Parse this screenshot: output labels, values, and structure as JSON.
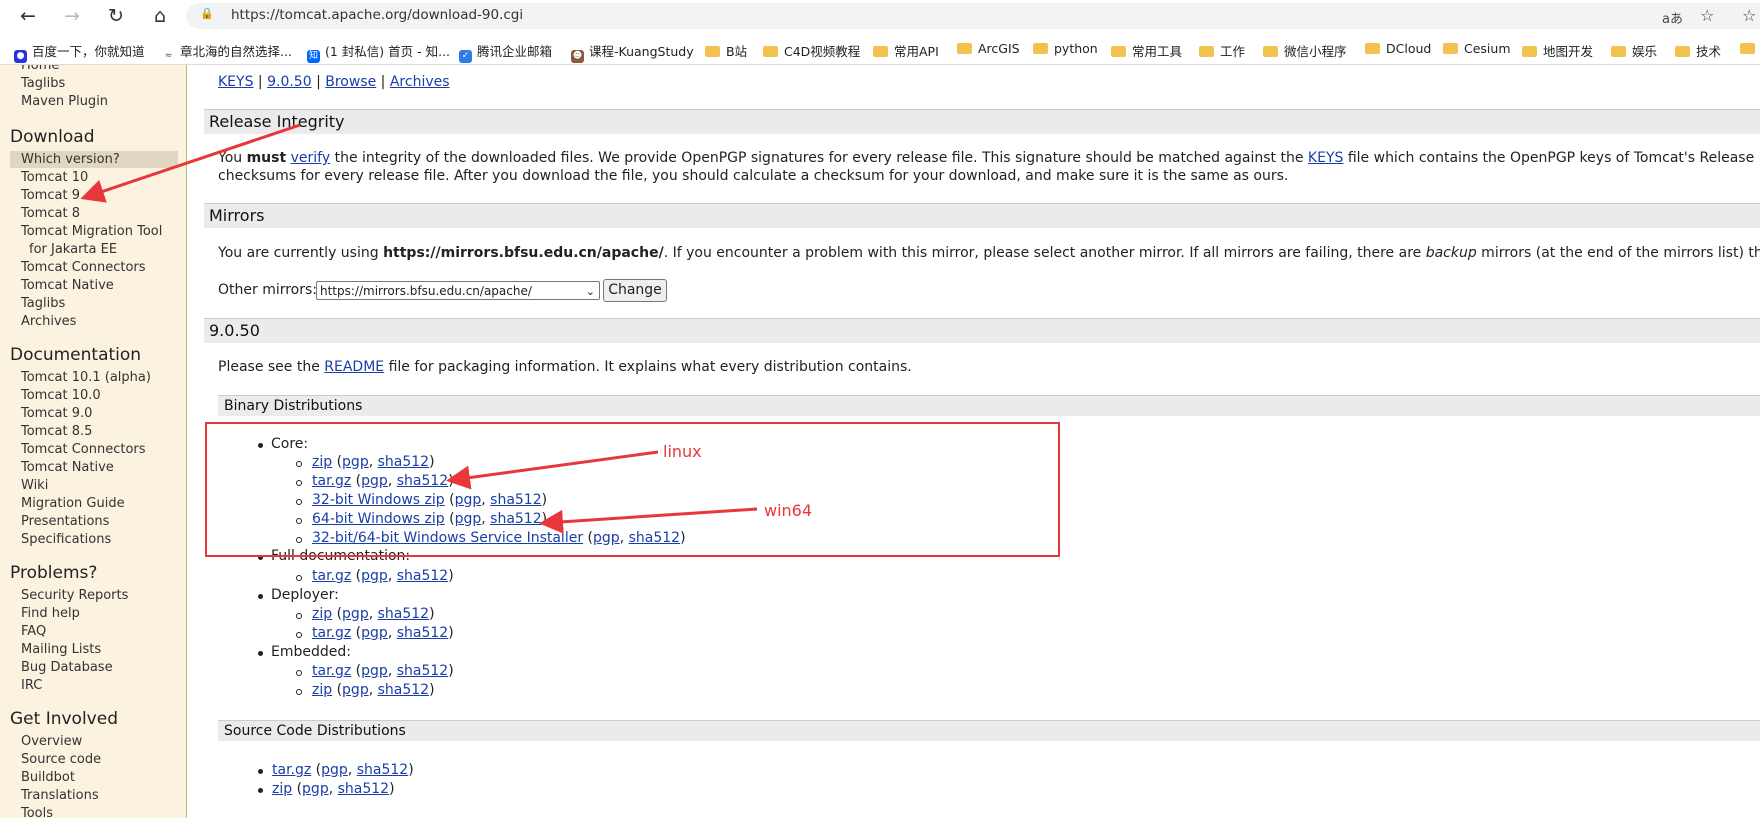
{
  "browser": {
    "url": "https://tomcat.apache.org/download-90.cgi",
    "bookmarks": [
      {
        "label": "百度一下，你就知道",
        "kind": "site",
        "color": "#2932e1"
      },
      {
        "label": "章北海的自然选择...",
        "kind": "site",
        "color": "#555555"
      },
      {
        "label": "(1 封私信) 首页 - 知...",
        "kind": "site",
        "color": "#0066ff"
      },
      {
        "label": "腾讯企业邮箱",
        "kind": "site",
        "color": "#2f7bea"
      },
      {
        "label": "课程-KuangStudy",
        "kind": "site",
        "color": "#8a5a3a"
      },
      {
        "label": "B站",
        "kind": "folder"
      },
      {
        "label": "C4D视频教程",
        "kind": "folder"
      },
      {
        "label": "常用API",
        "kind": "folder"
      },
      {
        "label": "ArcGIS",
        "kind": "folder"
      },
      {
        "label": "python",
        "kind": "folder"
      },
      {
        "label": "常用工具",
        "kind": "folder"
      },
      {
        "label": "工作",
        "kind": "folder"
      },
      {
        "label": "微信小程序",
        "kind": "folder"
      },
      {
        "label": "DCloud",
        "kind": "folder"
      },
      {
        "label": "Cesium",
        "kind": "folder"
      },
      {
        "label": "地图开发",
        "kind": "folder"
      },
      {
        "label": "娱乐",
        "kind": "folder"
      },
      {
        "label": "技术",
        "kind": "folder"
      }
    ]
  },
  "sidebar": {
    "top_items": [
      "Home",
      "Taglibs",
      "Maven Plugin"
    ],
    "download": {
      "heading": "Download",
      "items": [
        "Which version?",
        "Tomcat 10",
        "Tomcat 9",
        "Tomcat 8",
        "Tomcat Migration Tool",
        "for Jakarta EE",
        "Tomcat Connectors",
        "Tomcat Native",
        "Taglibs",
        "Archives"
      ]
    },
    "documentation": {
      "heading": "Documentation",
      "items": [
        "Tomcat 10.1 (alpha)",
        "Tomcat 10.0",
        "Tomcat 9.0",
        "Tomcat 8.5",
        "Tomcat Connectors",
        "Tomcat Native",
        "Wiki",
        "Migration Guide",
        "Presentations",
        "Specifications"
      ]
    },
    "problems": {
      "heading": "Problems?",
      "items": [
        "Security Reports",
        "Find help",
        "FAQ",
        "Mailing Lists",
        "Bug Database",
        "IRC"
      ]
    },
    "involved": {
      "heading": "Get Involved",
      "items": [
        "Overview",
        "Source code",
        "Buildbot",
        "Translations",
        "Tools"
      ]
    }
  },
  "content": {
    "top_links": [
      "KEYS",
      "9.0.50",
      "Browse",
      "Archives"
    ],
    "release_integrity": {
      "title": "Release Integrity",
      "line1_a": "You ",
      "line1_must": "must",
      "line1_verify": "verify",
      "line1_b": " the integrity of the downloaded files. We provide OpenPGP signatures for every release file. This signature should be matched against the ",
      "line1_keys": "KEYS",
      "line1_c": " file which contains the OpenPGP keys of Tomcat's Release Managers. We also",
      "line2": "checksums for every release file. After you download the file, you should calculate a checksum for your download, and make sure it is the same as ours."
    },
    "mirrors": {
      "title": "Mirrors",
      "text_a": "You are currently using ",
      "text_mirror": "https://mirrors.bfsu.edu.cn/apache/",
      "text_b": ". If you encounter a problem with this mirror, please select another mirror. If all mirrors are failing, there are ",
      "text_backup": "backup",
      "text_c": " mirrors (at the end of the mirrors list) that should be availa",
      "other_label": "Other mirrors:",
      "selected": "https://mirrors.bfsu.edu.cn/apache/",
      "change_label": "Change"
    },
    "version": {
      "title": "9.0.50",
      "readme_a": "Please see the ",
      "readme_link": "README",
      "readme_b": " file for packaging information. It explains what every distribution contains."
    },
    "binary": {
      "title": "Binary Distributions",
      "core_label": "Core:",
      "core": [
        "zip",
        "tar.gz",
        "32-bit Windows zip",
        "64-bit Windows zip",
        "32-bit/64-bit Windows Service Installer"
      ],
      "fulldoc_label": "Full documentation:",
      "fulldoc": [
        "tar.gz"
      ],
      "deployer_label": "Deployer:",
      "deployer": [
        "zip",
        "tar.gz"
      ],
      "embedded_label": "Embedded:",
      "embedded": [
        "tar.gz",
        "zip"
      ]
    },
    "source": {
      "title": "Source Code Distributions",
      "items": [
        "tar.gz",
        "zip"
      ]
    },
    "pgp": "pgp",
    "sha512": "sha512"
  },
  "annotations": {
    "linux": "linux",
    "win64": "win64",
    "color": "#e8373a"
  }
}
